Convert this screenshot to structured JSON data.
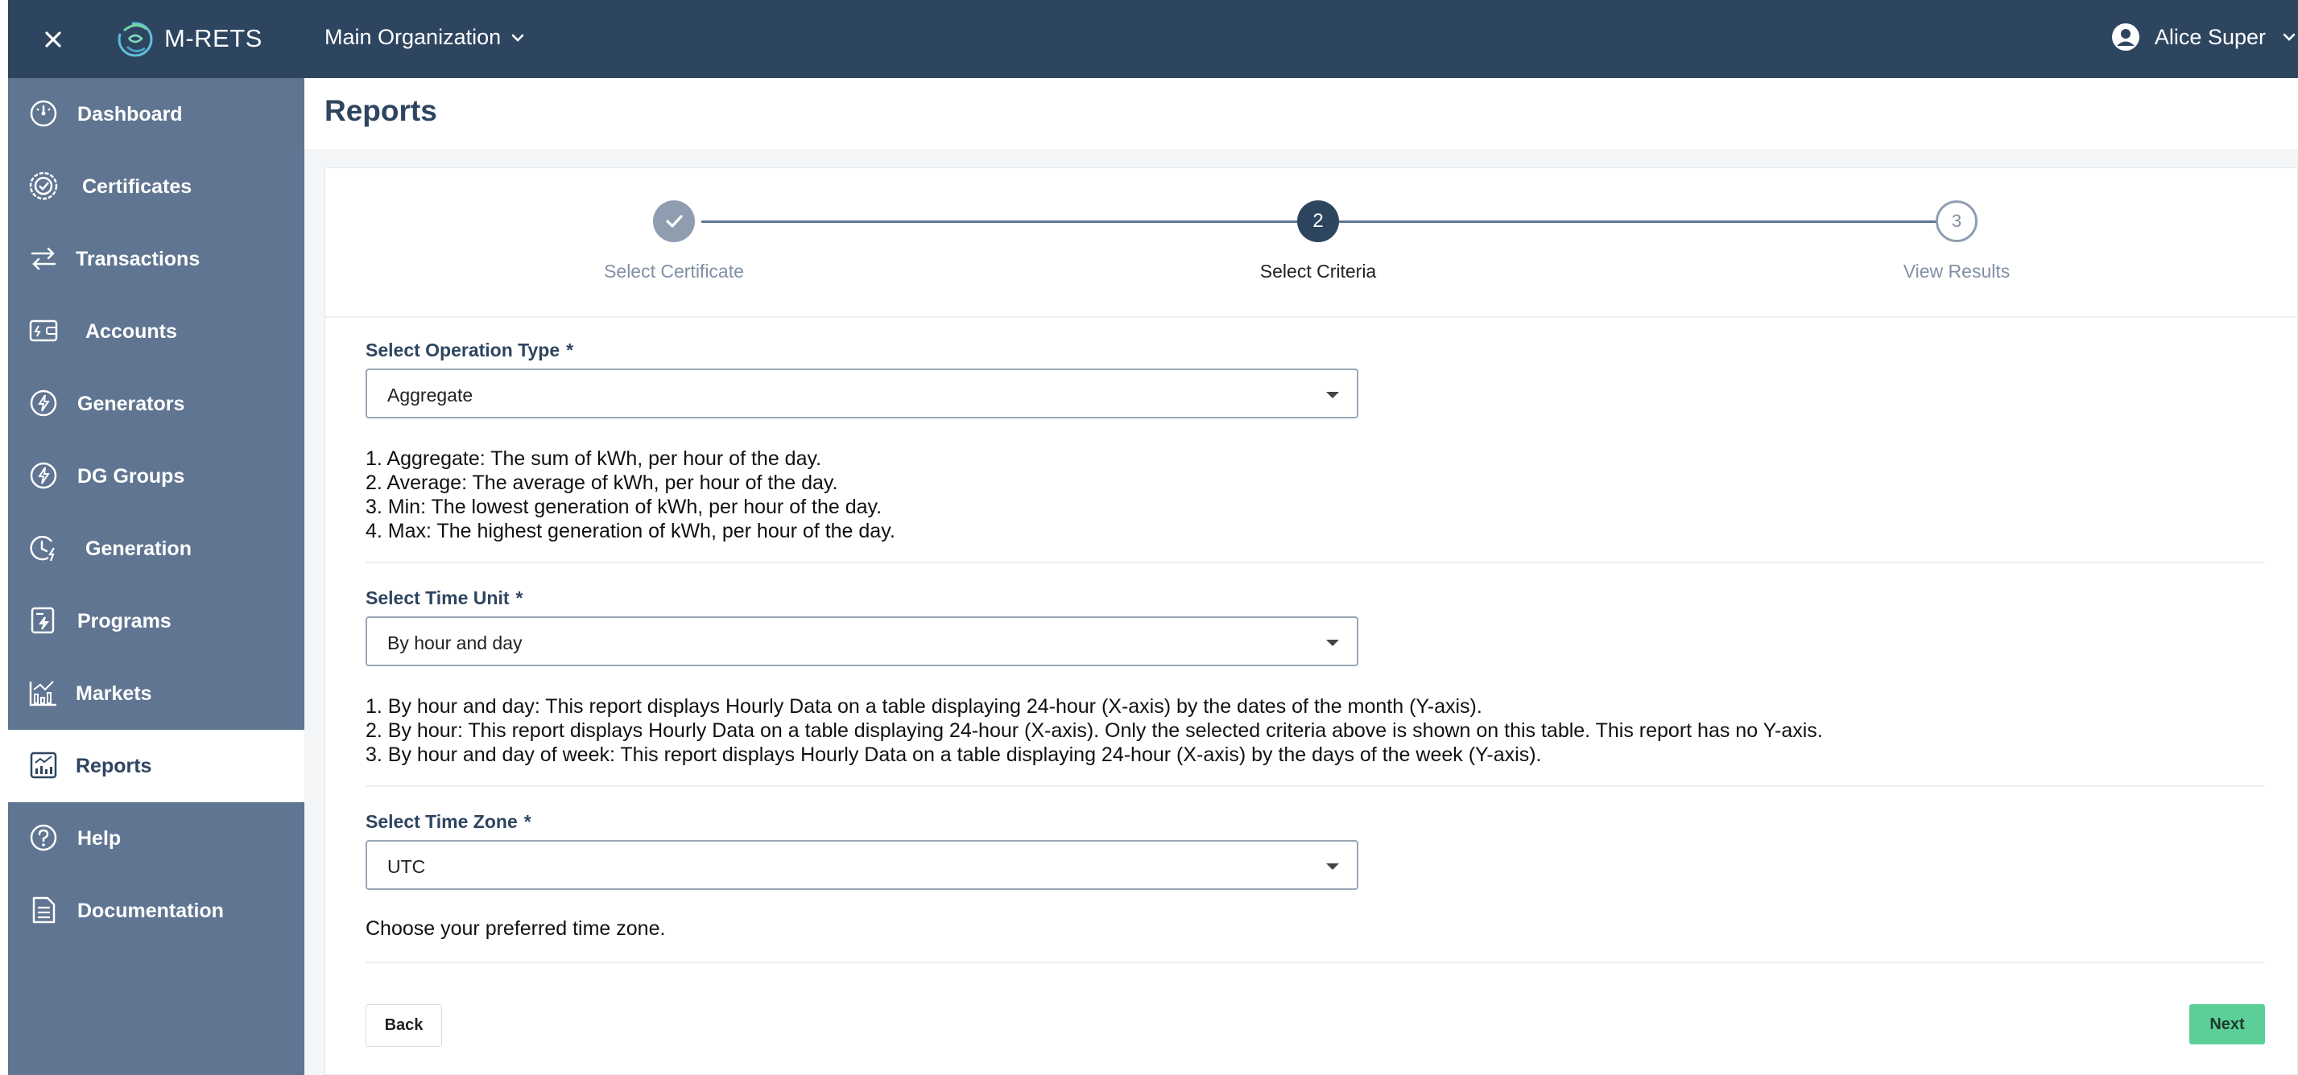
{
  "app": {
    "brand": "M-RETS",
    "organization": "Main Organization",
    "user_name": "Alice Super"
  },
  "sidebar": {
    "items": [
      {
        "label": "Dashboard",
        "icon": "speedometer-icon"
      },
      {
        "label": "Certificates",
        "icon": "certificate-badge-icon"
      },
      {
        "label": "Transactions",
        "icon": "transfer-arrows-icon"
      },
      {
        "label": "Accounts",
        "icon": "wallet-icon"
      },
      {
        "label": "Generators",
        "icon": "lightning-circle-icon"
      },
      {
        "label": "DG Groups",
        "icon": "lightning-circle-icon"
      },
      {
        "label": "Generation",
        "icon": "clock-bolt-icon"
      },
      {
        "label": "Programs",
        "icon": "document-bolt-icon"
      },
      {
        "label": "Markets",
        "icon": "bar-chart-icon"
      },
      {
        "label": "Reports",
        "icon": "report-chart-icon",
        "active": true
      },
      {
        "label": "Help",
        "icon": "question-circle-icon"
      },
      {
        "label": "Documentation",
        "icon": "document-lines-icon"
      }
    ]
  },
  "page": {
    "title": "Reports"
  },
  "stepper": {
    "steps": [
      {
        "number": "1",
        "label": "Select Certificate",
        "state": "completed"
      },
      {
        "number": "2",
        "label": "Select Criteria",
        "state": "active"
      },
      {
        "number": "3",
        "label": "View Results",
        "state": "upcoming"
      }
    ]
  },
  "form": {
    "operation_type": {
      "label": "Select Operation Type",
      "required_mark": "*",
      "value": "Aggregate",
      "descriptions": [
        "1. Aggregate: The sum of kWh, per hour of the day.",
        "2. Average: The average of kWh, per hour of the day.",
        "3. Min: The lowest generation of kWh, per hour of the day.",
        "4. Max: The highest generation of kWh, per hour of the day."
      ]
    },
    "time_unit": {
      "label": "Select Time Unit",
      "required_mark": "*",
      "value": "By hour and day",
      "descriptions": [
        "1. By hour and day: This report displays Hourly Data on a table displaying 24-hour (X-axis) by the dates of the month (Y-axis).",
        "2. By hour: This report displays Hourly Data on a table displaying 24-hour (X-axis). Only the selected criteria above is shown on this table. This report has no Y-axis.",
        "3. By hour and day of week: This report displays Hourly Data on a table displaying 24-hour (X-axis) by the days of the week (Y-axis)."
      ]
    },
    "time_zone": {
      "label": "Select Time Zone",
      "required_mark": "*",
      "value": "UTC",
      "description": "Choose your preferred time zone."
    }
  },
  "buttons": {
    "back": "Back",
    "next": "Next"
  },
  "colors": {
    "topbar": "#2e4560",
    "sidebar": "#5f7591",
    "accent_green": "#5ccf98"
  }
}
